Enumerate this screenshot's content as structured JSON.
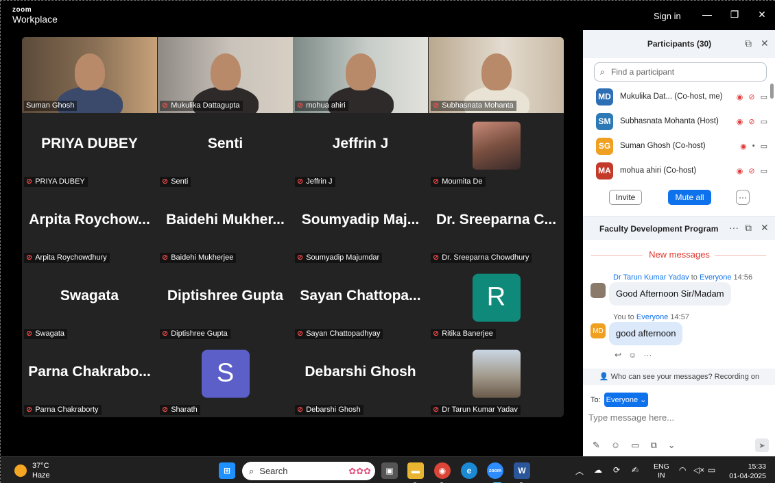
{
  "titlebar": {
    "brand_top": "zoom",
    "brand_bottom": "Workplace",
    "signin": "Sign in",
    "minimize": "—",
    "restore": "❐",
    "close": "✕"
  },
  "gallery": {
    "tiles": [
      {
        "caption": "Suman Ghosh",
        "big": "",
        "kind": "video",
        "muted": false,
        "active": true
      },
      {
        "caption": "Mukulika Dattagupta",
        "big": "",
        "kind": "video",
        "muted": true
      },
      {
        "caption": "mohua ahiri",
        "big": "",
        "kind": "video",
        "muted": true
      },
      {
        "caption": "Subhasnata Mohanta",
        "big": "",
        "kind": "video",
        "muted": true
      },
      {
        "caption": "PRIYA DUBEY",
        "big": "PRIYA DUBEY",
        "kind": "name",
        "muted": true
      },
      {
        "caption": "Senti",
        "big": "Senti",
        "kind": "name",
        "muted": true
      },
      {
        "caption": "Jeffrin J",
        "big": "Jeffrin J",
        "kind": "name",
        "muted": true
      },
      {
        "caption": "Moumita De",
        "big": "",
        "kind": "photo",
        "muted": true
      },
      {
        "caption": "Arpita Roychowdhury",
        "big": "Arpita  Roychow...",
        "kind": "name",
        "muted": true
      },
      {
        "caption": "Baidehi Mukherjee",
        "big": "Baidehi  Mukher...",
        "kind": "name",
        "muted": true
      },
      {
        "caption": "Soumyadip Majumdar",
        "big": "Soumyadip  Maj...",
        "kind": "name",
        "muted": true
      },
      {
        "caption": "Dr. Sreeparna Chowdhury",
        "big": "Dr.  Sreeparna  C...",
        "kind": "name",
        "muted": true
      },
      {
        "caption": "Swagata",
        "big": "Swagata",
        "kind": "name",
        "muted": true
      },
      {
        "caption": "Diptishree Gupta",
        "big": "Diptishree Gupta",
        "kind": "name",
        "muted": true
      },
      {
        "caption": "Sayan Chattopadhyay",
        "big": "Sayan  Chattopa...",
        "kind": "name",
        "muted": true
      },
      {
        "caption": "Ritika Banerjee",
        "big": "R",
        "kind": "letter",
        "color": "#0f8a7a",
        "muted": true
      },
      {
        "caption": "Parna Chakraborty",
        "big": "Parna  Chakrabo...",
        "kind": "name",
        "muted": true
      },
      {
        "caption": "Sharath",
        "big": "S",
        "kind": "letter",
        "color": "#5b5fc7",
        "muted": true
      },
      {
        "caption": "Debarshi Ghosh",
        "big": "Debarshi Ghosh",
        "kind": "name",
        "muted": true
      },
      {
        "caption": "Dr Tarun Kumar Yadav",
        "big": "",
        "kind": "photo2",
        "muted": true
      }
    ]
  },
  "participants": {
    "title": "Participants (30)",
    "search_placeholder": "Find a participant",
    "rows": [
      {
        "initials": "MD",
        "color": "#2d6fb5",
        "name": "Mukulika Dat... (Co-host, me)",
        "mic": "off"
      },
      {
        "initials": "SM",
        "color": "#2d79b5",
        "name": "Subhasnata Mohanta (Host)",
        "mic": "off"
      },
      {
        "initials": "SG",
        "color": "#f0a020",
        "name": "Suman Ghosh (Co-host)",
        "mic": "on"
      },
      {
        "initials": "MA",
        "color": "#c43a2a",
        "name": "mohua ahiri (Co-host)",
        "mic": "off"
      }
    ],
    "invite": "Invite",
    "mute_all": "Mute all",
    "more": "···"
  },
  "chat": {
    "title": "Faculty Development Program",
    "new_messages": "New messages",
    "messages": [
      {
        "sender": "Dr Tarun Kumar Yadav",
        "to_word": "to",
        "to": "Everyone",
        "time": "14:56",
        "text": "Good Afternoon Sir/Madam"
      },
      {
        "sender": "You",
        "to_word": "to",
        "to": "Everyone",
        "time": "14:57",
        "text": "good afternoon",
        "avatar": "MD"
      }
    ],
    "privacy": "Who can see your messages? Recording on",
    "to_label": "To:",
    "to_value": "Everyone",
    "placeholder": "Type message here..."
  },
  "taskbar": {
    "temp": "37°C",
    "weather": "Haze",
    "search": "Search",
    "lang_top": "ENG",
    "lang_bottom": "IN",
    "time": "15:33",
    "date": "01-04-2025"
  }
}
